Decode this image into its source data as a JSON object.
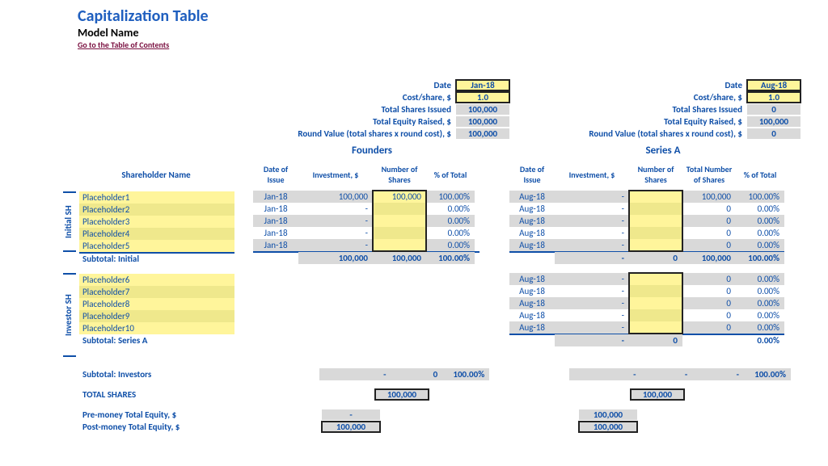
{
  "header": {
    "title": "Capitalization Table",
    "model_name": "Model Name",
    "toc_link": "Go to the Table of Contents"
  },
  "meta_labels": {
    "date": "Date",
    "cost_share": "Cost/share, $",
    "total_shares": "Total Shares Issued",
    "total_equity": "Total Equity Raised, $",
    "round_value": "Round Value (total shares x round cost), $"
  },
  "col_headers": {
    "shareholder": "Shareholder Name",
    "date_of_issue": "Date of Issue",
    "investment": "Investment, $",
    "num_shares": "Number of Shares",
    "total_num_shares": "Total Number of Shares",
    "pct_total": "% of Total"
  },
  "sections": {
    "initial": "Initial SH",
    "investor": "Investor SH"
  },
  "founders": {
    "title": "Founders",
    "date": "Jan-18",
    "cost_share": "1.0",
    "total_shares": "100,000",
    "total_equity": "100,000",
    "round_value": "100,000"
  },
  "seriesA": {
    "title": "Series A",
    "date": "Aug-18",
    "cost_share": "1.0",
    "total_shares": "0",
    "total_equity": "100,000",
    "round_value": "0"
  },
  "initial_sh": [
    {
      "name": "Placeholder1",
      "f_date": "Jan-18",
      "f_inv": "100,000",
      "f_num": "100,000",
      "f_pct": "100.00%",
      "s_date": "Aug-18",
      "s_inv": "-",
      "s_num": "",
      "s_tot": "100,000",
      "s_pct": "100.00%"
    },
    {
      "name": "Placeholder2",
      "f_date": "Jan-18",
      "f_inv": "-",
      "f_num": "",
      "f_pct": "0.00%",
      "s_date": "Aug-18",
      "s_inv": "-",
      "s_num": "",
      "s_tot": "0",
      "s_pct": "0.00%"
    },
    {
      "name": "Placeholder3",
      "f_date": "Jan-18",
      "f_inv": "-",
      "f_num": "",
      "f_pct": "0.00%",
      "s_date": "Aug-18",
      "s_inv": "-",
      "s_num": "",
      "s_tot": "0",
      "s_pct": "0.00%"
    },
    {
      "name": "Placeholder4",
      "f_date": "Jan-18",
      "f_inv": "-",
      "f_num": "",
      "f_pct": "0.00%",
      "s_date": "Aug-18",
      "s_inv": "-",
      "s_num": "",
      "s_tot": "0",
      "s_pct": "0.00%"
    },
    {
      "name": "Placeholder5",
      "f_date": "Jan-18",
      "f_inv": "-",
      "f_num": "",
      "f_pct": "0.00%",
      "s_date": "Aug-18",
      "s_inv": "-",
      "s_num": "",
      "s_tot": "0",
      "s_pct": "0.00%"
    }
  ],
  "investor_sh": [
    {
      "name": "Placeholder6",
      "s_date": "Aug-18",
      "s_inv": "-",
      "s_num": "",
      "s_tot": "0",
      "s_pct": "0.00%"
    },
    {
      "name": "Placeholder7",
      "s_date": "Aug-18",
      "s_inv": "-",
      "s_num": "",
      "s_tot": "0",
      "s_pct": "0.00%"
    },
    {
      "name": "Placeholder8",
      "s_date": "Aug-18",
      "s_inv": "-",
      "s_num": "",
      "s_tot": "0",
      "s_pct": "0.00%"
    },
    {
      "name": "Placeholder9",
      "s_date": "Aug-18",
      "s_inv": "-",
      "s_num": "",
      "s_tot": "0",
      "s_pct": "0.00%"
    },
    {
      "name": "Placeholder10",
      "s_date": "Aug-18",
      "s_inv": "-",
      "s_num": "",
      "s_tot": "0",
      "s_pct": "0.00%"
    }
  ],
  "subtotals": {
    "initial_label": "Subtotal: Initial",
    "initial_f_inv": "100,000",
    "initial_f_num": "100,000",
    "initial_f_pct": "100.00%",
    "initial_s_inv": "-",
    "initial_s_num": "0",
    "initial_s_tot": "100,000",
    "initial_s_pct": "100.00%",
    "seriesA_label": "Subtotal: Series A",
    "seriesA_s_inv": "-",
    "seriesA_s_num": "0",
    "seriesA_s_tot": "",
    "seriesA_s_pct": "0.00%",
    "investors_label": "Subtotal: Investors",
    "investors_f_inv": "-",
    "investors_f_num": "0",
    "investors_f_pct": "100.00%",
    "investors_s_inv": "-",
    "investors_s_num": "-",
    "investors_s_tot": "-",
    "investors_s_pct": "100.00%"
  },
  "totals": {
    "total_shares_label": "TOTAL SHARES",
    "total_shares_f": "100,000",
    "total_shares_s": "100,000",
    "pre_money_label": "Pre-money Total Equity, $",
    "pre_money_f": "-",
    "pre_money_s": "100,000",
    "post_money_label": "Post-money Total Equity, $",
    "post_money_f": "100,000",
    "post_money_s": "100,000"
  }
}
